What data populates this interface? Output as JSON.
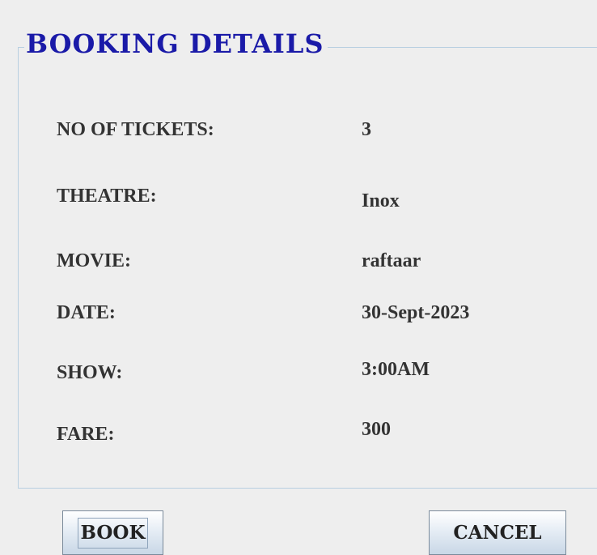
{
  "panel": {
    "title": "BOOKING DETAILS"
  },
  "details": [
    {
      "label": "NO OF TICKETS:",
      "value": "3"
    },
    {
      "label": "THEATRE:",
      "value": "Inox"
    },
    {
      "label": "MOVIE:",
      "value": "raftaar"
    },
    {
      "label": "DATE:",
      "value": "30-Sept-2023"
    },
    {
      "label": "SHOW:",
      "value": "3:00AM"
    },
    {
      "label": "FARE:",
      "value": "300"
    }
  ],
  "buttons": {
    "book_label": "BOOK",
    "cancel_label": "CANCEL"
  },
  "colors": {
    "title": "#1a1aa8",
    "text": "#333333",
    "background": "#eeeeee",
    "border": "#b8cfe0"
  }
}
